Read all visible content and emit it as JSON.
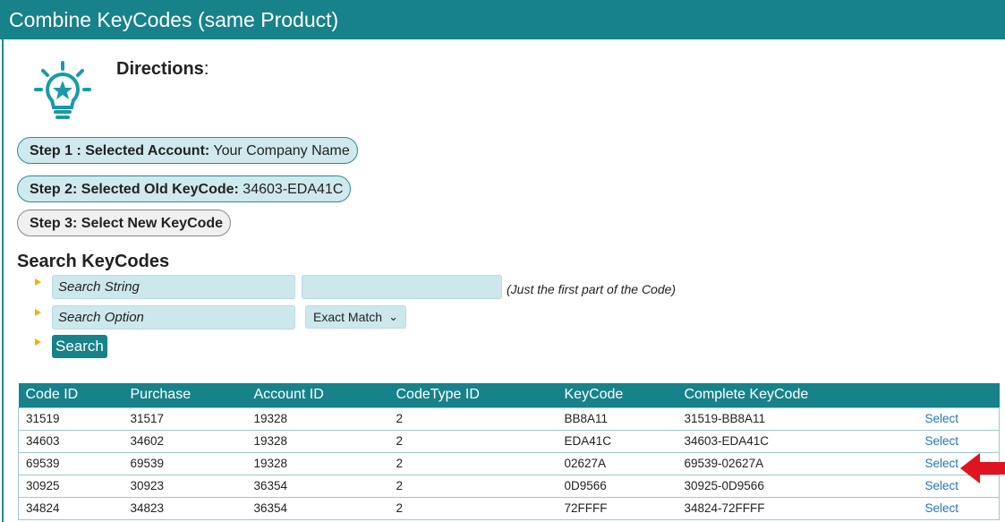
{
  "window": {
    "title": "Combine KeyCodes (same Product)"
  },
  "directions": {
    "label": "Directions",
    "colon": ":"
  },
  "steps": [
    {
      "label": "Step 1 : Selected Account:",
      "value": "Your Company Name"
    },
    {
      "label": "Step 2: Selected Old KeyCode:",
      "value": "34603-EDA41C"
    },
    {
      "label": "Step 3: Select New KeyCode",
      "value": ""
    }
  ],
  "search": {
    "title": "Search KeyCodes",
    "string_label": "Search String",
    "string_value": "",
    "hint": "(Just the first part of the Code)",
    "option_label": "Search Option",
    "option_selected": "Exact Match",
    "button_label": "Search"
  },
  "table": {
    "columns": [
      "Code ID",
      "Purchase",
      "Account ID",
      "CodeType ID",
      "KeyCode",
      "Complete KeyCode",
      ""
    ],
    "rows": [
      [
        "31519",
        "31517",
        "19328",
        "2",
        "BB8A11",
        "31519-BB8A11",
        "Select"
      ],
      [
        "34603",
        "34602",
        "19328",
        "2",
        "EDA41C",
        "34603-EDA41C",
        "Select"
      ],
      [
        "69539",
        "69539",
        "19328",
        "2",
        "02627A",
        "69539-02627A",
        "Select"
      ],
      [
        "30925",
        "30923",
        "36354",
        "2",
        "0D9566",
        "30925-0D9566",
        "Select"
      ],
      [
        "34824",
        "34823",
        "36354",
        "2",
        "72FFFF",
        "34824-72FFFF",
        "Select"
      ]
    ]
  },
  "colors": {
    "header": "#17828a",
    "pill": "#cfe9ee",
    "link": "#2277bb",
    "arrow": "#e0141e",
    "bullet": "#f0b400"
  },
  "icons": {
    "directions": "lightbulb-star-icon",
    "pointer": "red-arrow-icon"
  }
}
